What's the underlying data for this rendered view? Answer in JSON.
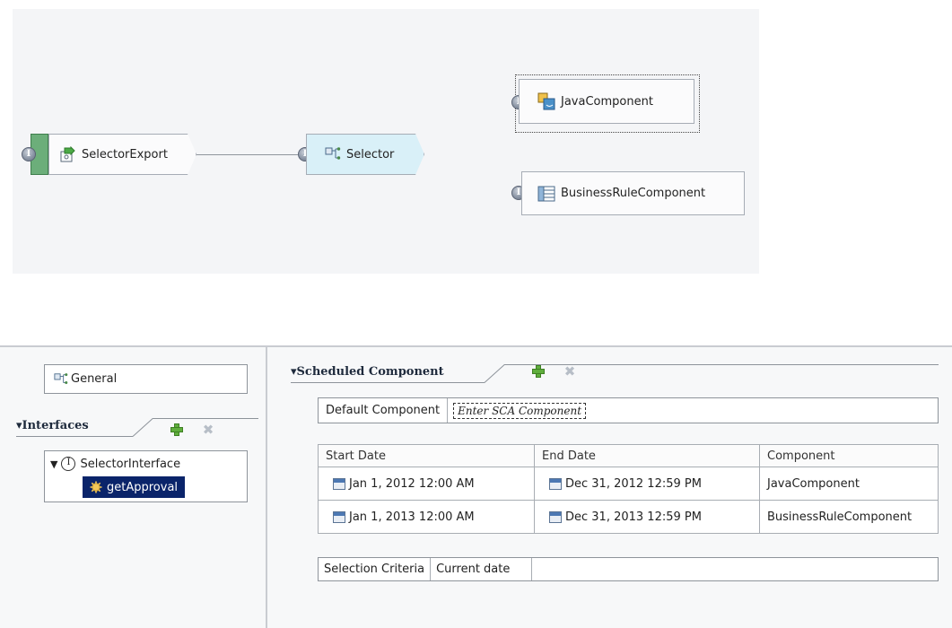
{
  "diagram": {
    "export_node": {
      "label": "SelectorExport",
      "icon": "export-icon"
    },
    "selector_node": {
      "label": "Selector",
      "icon": "selector-icon"
    },
    "java_node": {
      "label": "JavaComponent",
      "icon": "java-component-icon"
    },
    "rule_node": {
      "label": "BusinessRuleComponent",
      "icon": "business-rule-icon"
    },
    "interface_glyph": "I"
  },
  "left_panel": {
    "general_label": "General",
    "interfaces_title": "▾Interfaces",
    "tree": {
      "expander": "▼",
      "interface_badge": "I",
      "interface_label": "SelectorInterface",
      "operation_label": "getApproval"
    }
  },
  "right_panel": {
    "title": "▾Scheduled Component",
    "default_component_label": "Default Component",
    "default_component_placeholder": "Enter SCA Component",
    "columns": [
      "Start Date",
      "End Date",
      "Component"
    ],
    "rows": [
      {
        "start": "Jan 1, 2012 12:00 AM",
        "end": "Dec 31, 2012 12:59 PM",
        "component": "JavaComponent"
      },
      {
        "start": "Jan 1, 2013 12:00 AM",
        "end": "Dec 31, 2013 12:59 PM",
        "component": "BusinessRuleComponent"
      }
    ],
    "selection_criteria_label": "Selection Criteria",
    "selection_criteria_value": "Current date"
  },
  "colors": {
    "canvas_bg": "#f4f5f7",
    "selected_node": "#d9f0f8",
    "tree_selected": "#0a246a"
  }
}
